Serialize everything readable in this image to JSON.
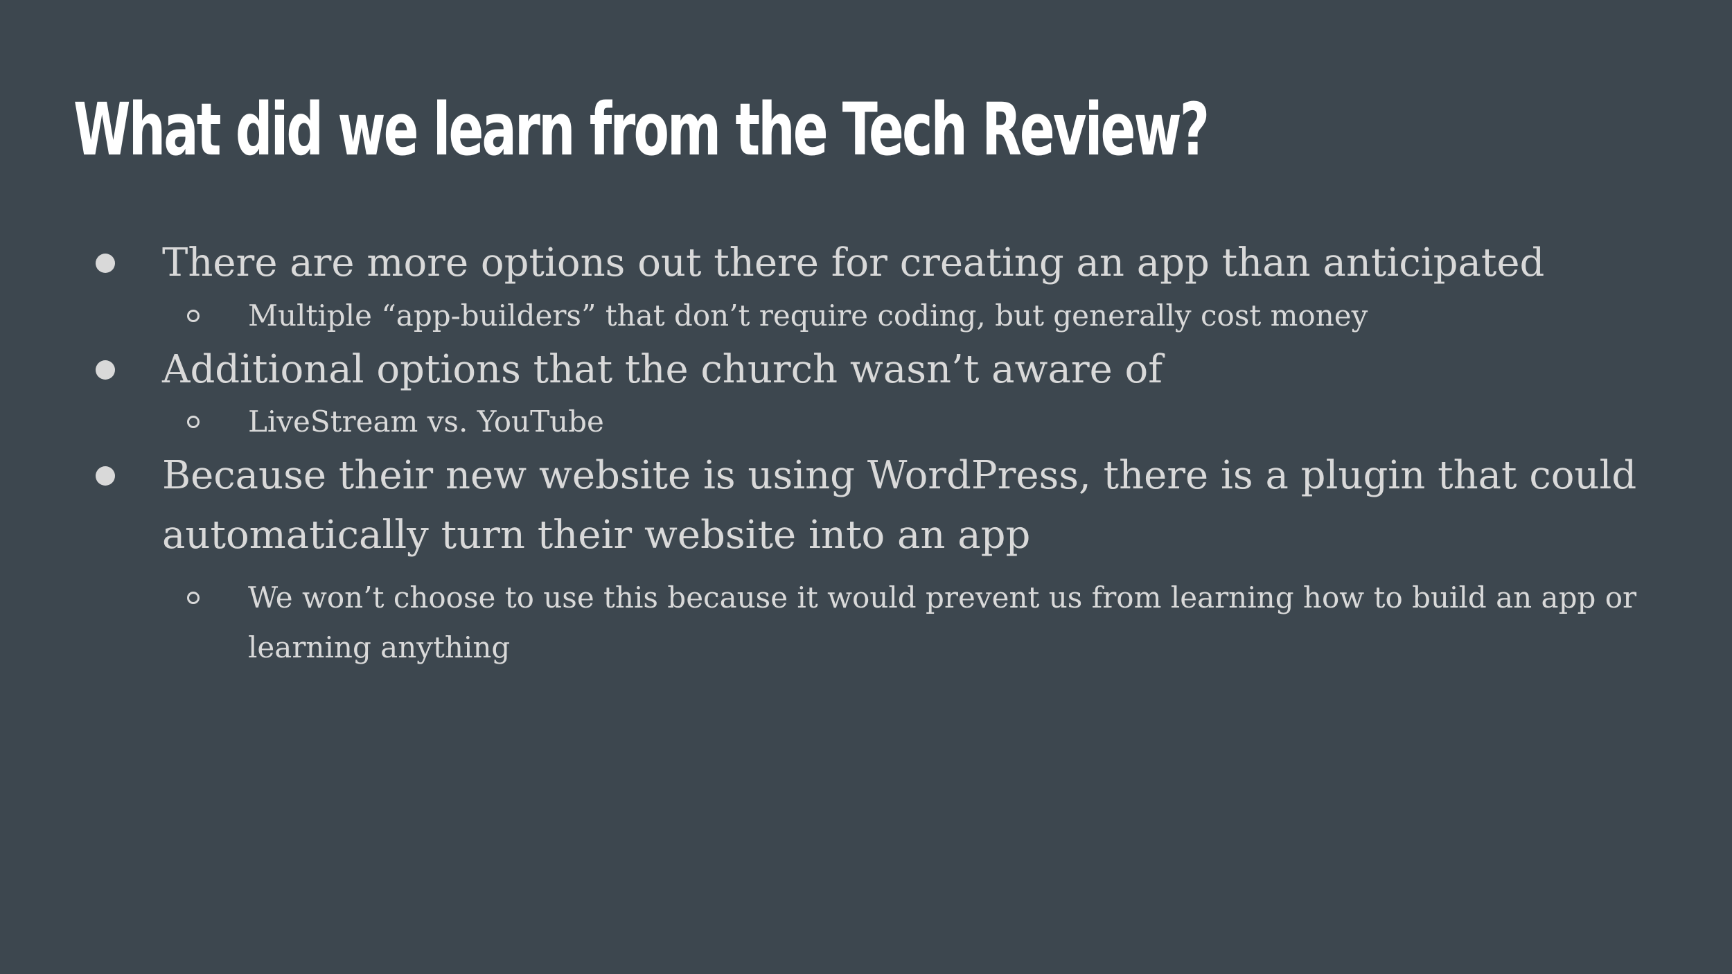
{
  "slide": {
    "title": "What did we learn from the Tech Review?",
    "bullets": [
      {
        "level": 1,
        "lines": [
          "There are more options out there for creating an app than anticipated"
        ]
      },
      {
        "level": 2,
        "lines": [
          "Multiple “app-builders” that don’t require coding, but generally cost money"
        ]
      },
      {
        "level": 1,
        "lines": [
          "Additional options that the church wasn’t aware of"
        ]
      },
      {
        "level": 2,
        "lines": [
          "LiveStream vs. YouTube"
        ]
      },
      {
        "level": 1,
        "lines": [
          "Because their new website is using WordPress, there is a plugin that could",
          "automatically turn their website into an app"
        ]
      },
      {
        "level": 2,
        "lines": [
          "We won’t choose to use this because it would prevent us from learning how to build an app or",
          "learning anything"
        ]
      }
    ]
  }
}
